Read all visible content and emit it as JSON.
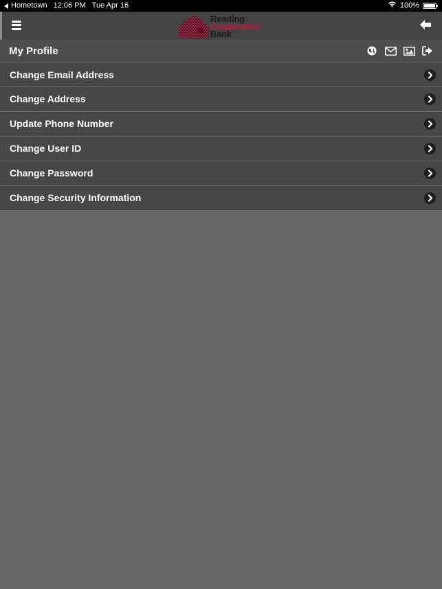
{
  "status_bar": {
    "back_app": "Hometown",
    "time": "12:06 PM",
    "date": "Tue Apr 16",
    "battery": "100%"
  },
  "header": {
    "logo_line1": "Reading",
    "logo_line2": "Cooperative",
    "logo_line3": "Bank",
    "menu_icon": "hamburger-menu-icon",
    "back_icon": "arrow-left-icon"
  },
  "title_bar": {
    "title": "My Profile",
    "icons": [
      "globe-icon",
      "envelope-icon",
      "image-icon",
      "sign-out-icon"
    ]
  },
  "menu": {
    "items": [
      {
        "label": "Change Email Address"
      },
      {
        "label": "Change Address"
      },
      {
        "label": "Update Phone Number"
      },
      {
        "label": "Change User ID"
      },
      {
        "label": "Change Password"
      },
      {
        "label": "Change Security Information"
      }
    ]
  },
  "colors": {
    "background": "#666666",
    "header": "#444444",
    "list_item": "#474747",
    "brand_red": "#c4173e"
  }
}
